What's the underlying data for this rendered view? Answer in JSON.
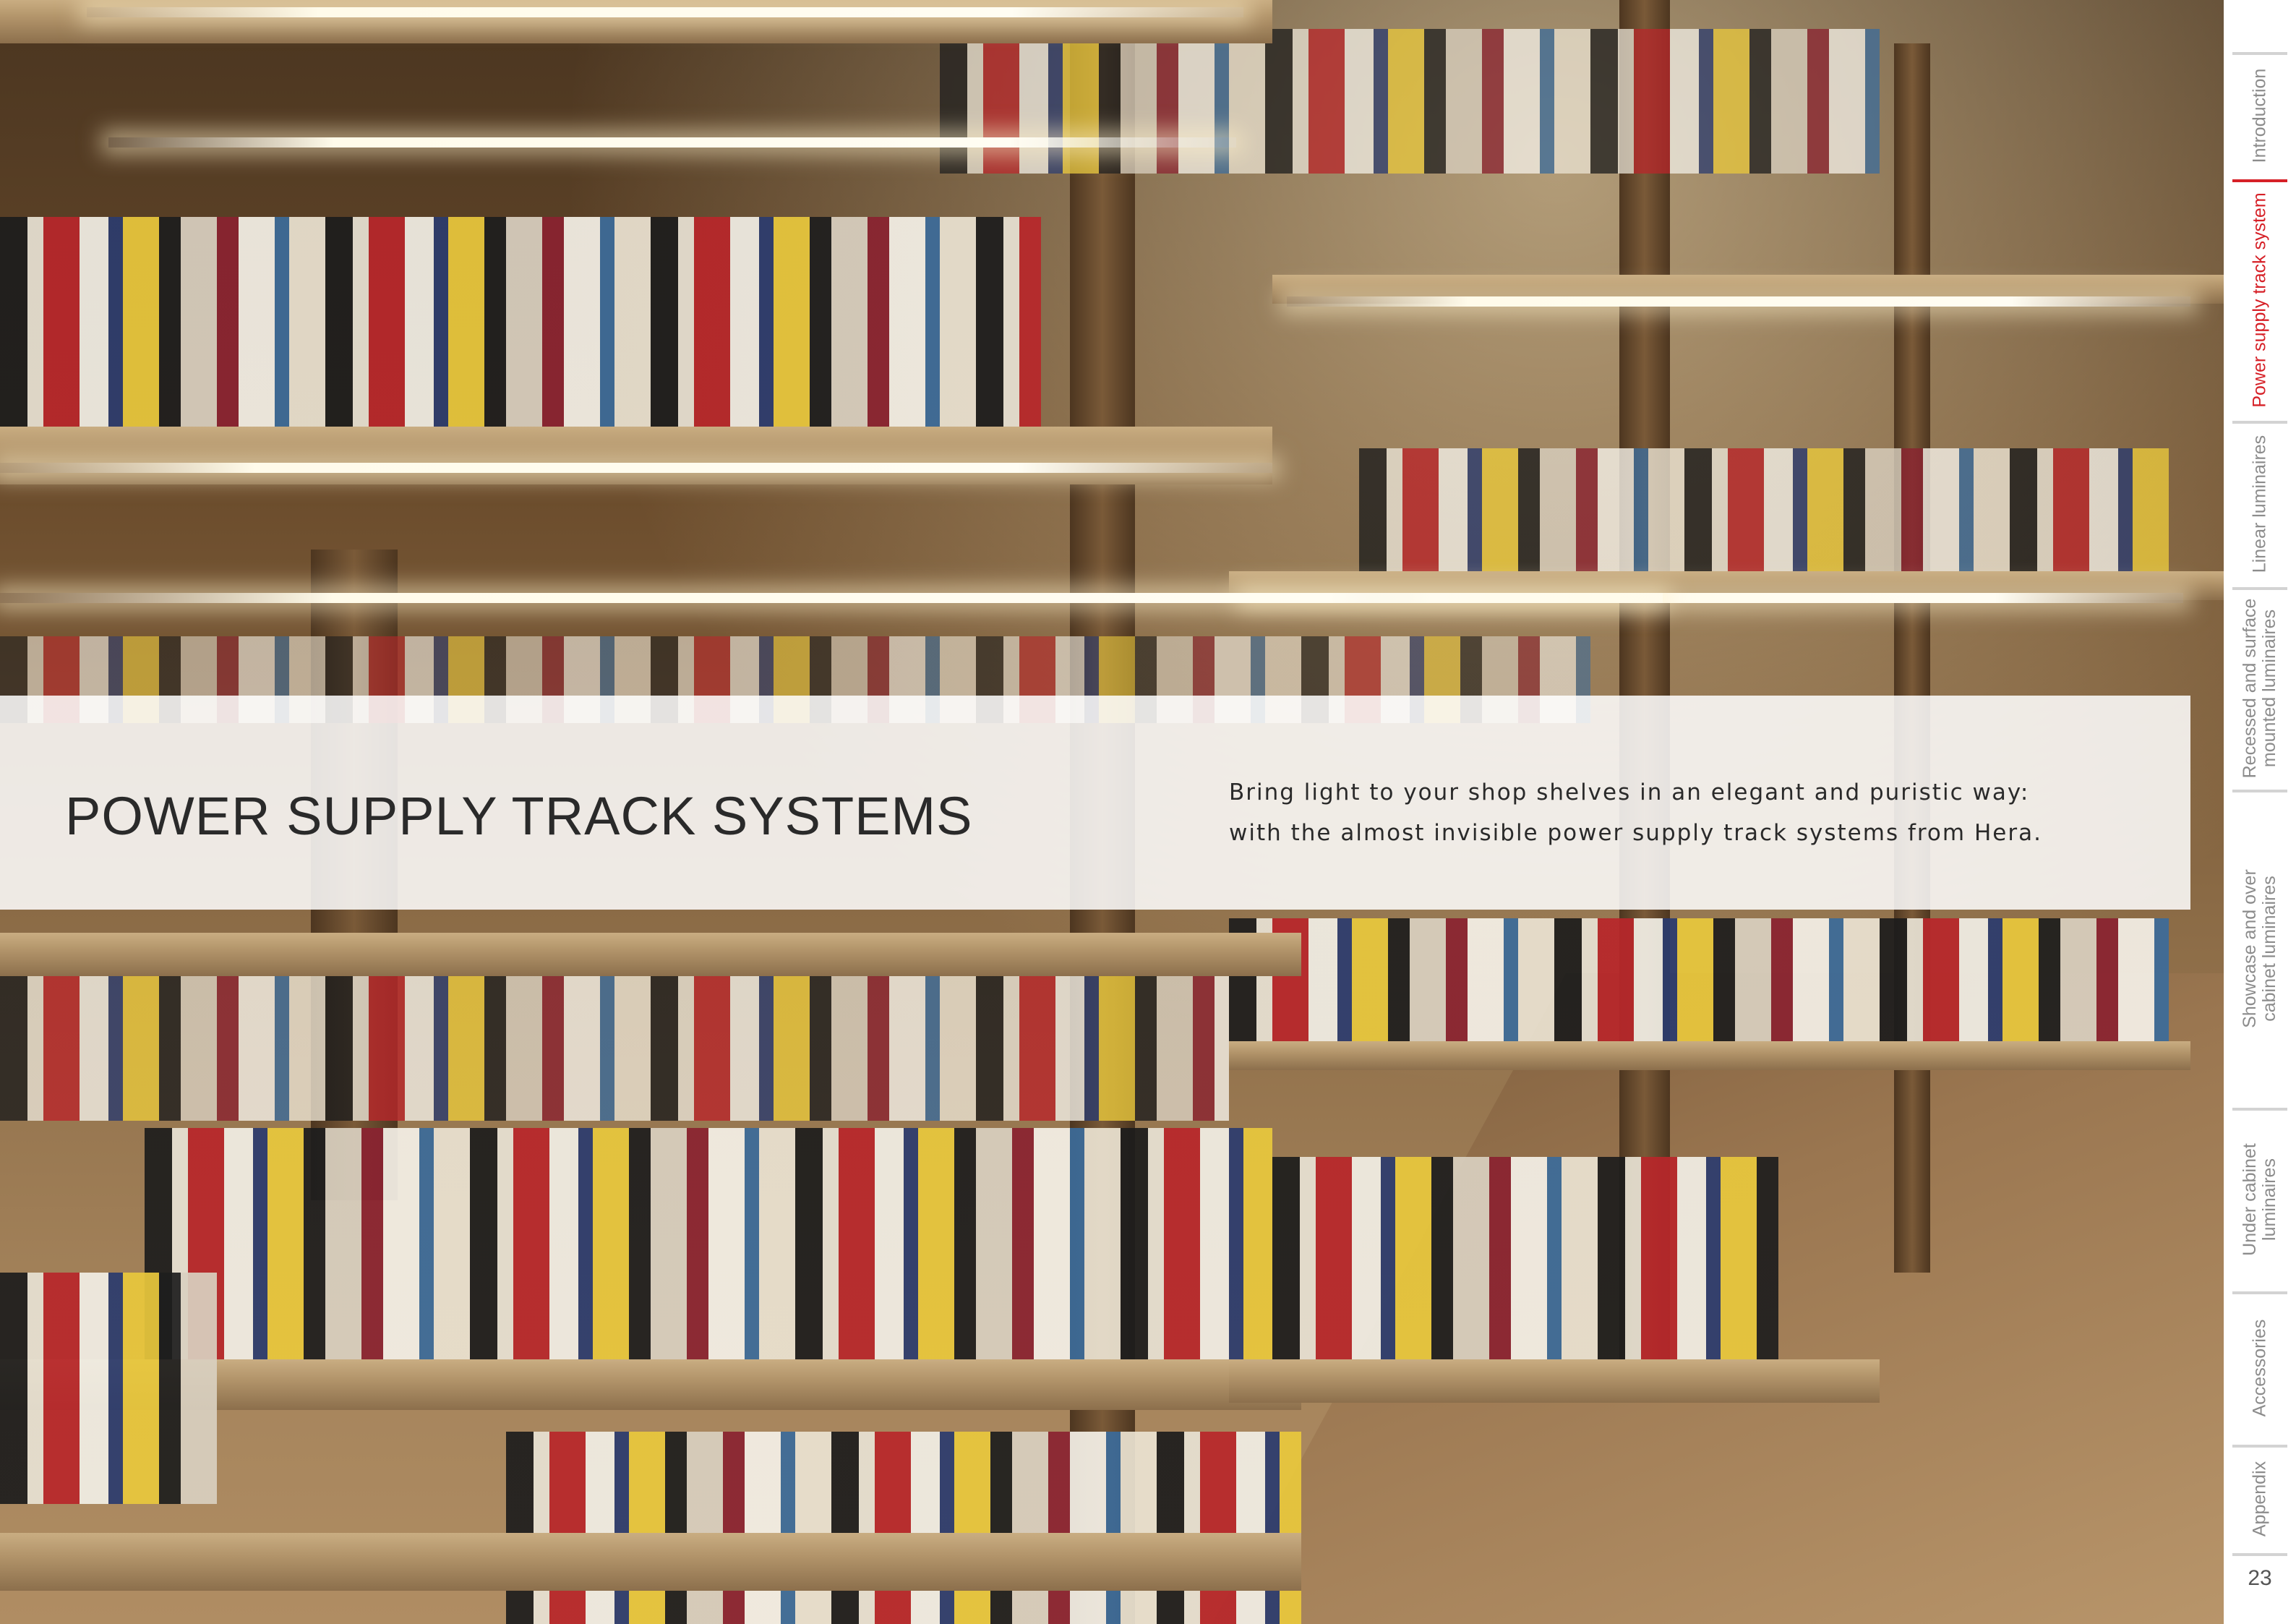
{
  "title": "POWER SUPPLY TRACK SYSTEMS",
  "tagline": {
    "line1": "Bring light to your shop shelves in an elegant and puristic way:",
    "line2": "with the almost invisible power supply track systems from Hera."
  },
  "side_nav": {
    "items": [
      {
        "label": "Introduction",
        "label2": "",
        "active": false
      },
      {
        "label": "Power supply track system",
        "label2": "",
        "active": true
      },
      {
        "label": "Linear luminaires",
        "label2": "",
        "active": false
      },
      {
        "label": "Recessed and surface",
        "label2": "mounted luminaires",
        "active": false
      },
      {
        "label": "Showcase and over",
        "label2": "cabinet luminaires",
        "active": false
      },
      {
        "label": "Under cabinet",
        "label2": "luminaires",
        "active": false
      },
      {
        "label": "Accessories",
        "label2": "",
        "active": false
      },
      {
        "label": "Appendix",
        "label2": "",
        "active": false
      }
    ]
  },
  "page_number": "23",
  "colors": {
    "accent": "#d62027",
    "inactive_nav": "#8c8c8c",
    "title_text": "#2a2a2a"
  }
}
